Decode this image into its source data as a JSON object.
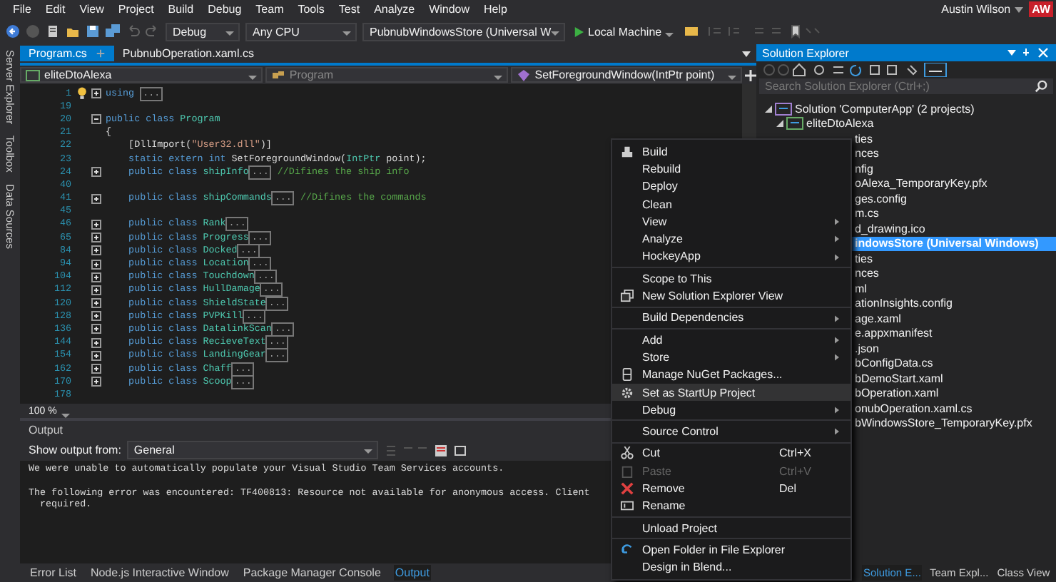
{
  "menu_bar": {
    "items": [
      "File",
      "Edit",
      "View",
      "Project",
      "Build",
      "Debug",
      "Team",
      "Tools",
      "Test",
      "Analyze",
      "Window",
      "Help"
    ],
    "user_name": "Austin Wilson",
    "user_initials": "AW"
  },
  "toolbar": {
    "configuration": "Debug",
    "platform": "Any CPU",
    "startup_project": "PubnubWindowsStore (Universal W",
    "run_target": "Local Machine"
  },
  "side_tabs": [
    "Server Explorer",
    "Toolbox",
    "Data Sources"
  ],
  "document_tabs": [
    {
      "label": "Program.cs",
      "selected": true
    },
    {
      "label": "PubnubOperation.xaml.cs",
      "selected": false
    }
  ],
  "navigation_bar": {
    "project": "eliteDtoAlexa",
    "type": "Program",
    "member": "SetForegroundWindow(IntPtr point)"
  },
  "editor": {
    "zoom": "100 %",
    "lines": [
      {
        "number": "1",
        "lightbulb": true,
        "collapsed": true,
        "tokens": [
          {
            "kind": "keyword",
            "text": "using "
          },
          {
            "kind": "collapsed",
            "text": "..."
          }
        ]
      },
      {
        "number": "19"
      },
      {
        "number": "20",
        "collapsed": false,
        "tokens": [
          {
            "kind": "keyword",
            "text": "public class "
          },
          {
            "kind": "type",
            "text": "Program"
          }
        ]
      },
      {
        "number": "21",
        "tokens": [
          {
            "kind": "plain",
            "text": "{"
          }
        ]
      },
      {
        "number": "22",
        "tokens": [
          {
            "kind": "plain",
            "text": "    [DllImport("
          },
          {
            "kind": "string",
            "text": "\"User32.dll\""
          },
          {
            "kind": "plain",
            "text": ")]"
          }
        ]
      },
      {
        "number": "23",
        "tokens": [
          {
            "kind": "keyword",
            "text": "    static extern int "
          },
          {
            "kind": "plain",
            "text": "SetForegroundWindow("
          },
          {
            "kind": "type",
            "text": "IntPtr"
          },
          {
            "kind": "plain",
            "text": " point);"
          }
        ]
      },
      {
        "number": "24",
        "collapsed": true,
        "tokens": [
          {
            "kind": "keyword",
            "text": "    public class "
          },
          {
            "kind": "type",
            "text": "shipInfo"
          },
          {
            "kind": "collapsed",
            "text": "..."
          },
          {
            "kind": "comment",
            "text": " //Difines the ship info"
          }
        ]
      },
      {
        "number": "40"
      },
      {
        "number": "41",
        "collapsed": true,
        "tokens": [
          {
            "kind": "keyword",
            "text": "    public class "
          },
          {
            "kind": "type",
            "text": "shipCommands"
          },
          {
            "kind": "collapsed",
            "text": "..."
          },
          {
            "kind": "comment",
            "text": " //Difines the commands"
          }
        ]
      },
      {
        "number": "45"
      },
      {
        "number": "46",
        "collapsed": true,
        "tokens": [
          {
            "kind": "keyword",
            "text": "    public class "
          },
          {
            "kind": "type",
            "text": "Rank"
          },
          {
            "kind": "collapsed",
            "text": "..."
          }
        ]
      },
      {
        "number": "65",
        "collapsed": true,
        "tokens": [
          {
            "kind": "keyword",
            "text": "    public class "
          },
          {
            "kind": "type",
            "text": "Progress"
          },
          {
            "kind": "collapsed",
            "text": "..."
          }
        ]
      },
      {
        "number": "84",
        "collapsed": true,
        "tokens": [
          {
            "kind": "keyword",
            "text": "    public class "
          },
          {
            "kind": "type",
            "text": "Docked"
          },
          {
            "kind": "collapsed",
            "text": "..."
          }
        ]
      },
      {
        "number": "94",
        "collapsed": true,
        "tokens": [
          {
            "kind": "keyword",
            "text": "    public class "
          },
          {
            "kind": "type",
            "text": "Location"
          },
          {
            "kind": "collapsed",
            "text": "..."
          }
        ]
      },
      {
        "number": "104",
        "collapsed": true,
        "tokens": [
          {
            "kind": "keyword",
            "text": "    public class "
          },
          {
            "kind": "type",
            "text": "Touchdown"
          },
          {
            "kind": "collapsed",
            "text": "..."
          }
        ]
      },
      {
        "number": "112",
        "collapsed": true,
        "tokens": [
          {
            "kind": "keyword",
            "text": "    public class "
          },
          {
            "kind": "type",
            "text": "HullDamage"
          },
          {
            "kind": "collapsed",
            "text": "..."
          }
        ]
      },
      {
        "number": "120",
        "collapsed": true,
        "tokens": [
          {
            "kind": "keyword",
            "text": "    public class "
          },
          {
            "kind": "type",
            "text": "ShieldState"
          },
          {
            "kind": "collapsed",
            "text": "..."
          }
        ]
      },
      {
        "number": "128",
        "collapsed": true,
        "tokens": [
          {
            "kind": "keyword",
            "text": "    public class "
          },
          {
            "kind": "type",
            "text": "PVPKill"
          },
          {
            "kind": "collapsed",
            "text": "..."
          }
        ]
      },
      {
        "number": "136",
        "collapsed": true,
        "tokens": [
          {
            "kind": "keyword",
            "text": "    public class "
          },
          {
            "kind": "type",
            "text": "DatalinkScan"
          },
          {
            "kind": "collapsed",
            "text": "..."
          }
        ]
      },
      {
        "number": "144",
        "collapsed": true,
        "tokens": [
          {
            "kind": "keyword",
            "text": "    public class "
          },
          {
            "kind": "type",
            "text": "RecieveText"
          },
          {
            "kind": "collapsed",
            "text": "..."
          }
        ]
      },
      {
        "number": "154",
        "collapsed": true,
        "tokens": [
          {
            "kind": "keyword",
            "text": "    public class "
          },
          {
            "kind": "type",
            "text": "LandingGear"
          },
          {
            "kind": "collapsed",
            "text": "..."
          }
        ]
      },
      {
        "number": "162",
        "collapsed": true,
        "tokens": [
          {
            "kind": "keyword",
            "text": "    public class "
          },
          {
            "kind": "type",
            "text": "Chaff"
          },
          {
            "kind": "collapsed",
            "text": "..."
          }
        ]
      },
      {
        "number": "170",
        "collapsed": true,
        "tokens": [
          {
            "kind": "keyword",
            "text": "    public class "
          },
          {
            "kind": "type",
            "text": "Scoop"
          },
          {
            "kind": "collapsed",
            "text": "..."
          }
        ]
      },
      {
        "number": "178"
      }
    ]
  },
  "output": {
    "title": "Output",
    "source_label": "Show output from:",
    "source": "General",
    "messages": [
      {
        "lines": [
          "We were unable to automatically populate your Visual Studio Team Services accounts."
        ]
      },
      {
        "lines": [
          "The following error was encountered: TF400813: Resource not available for anonymous access. Client",
          "required."
        ]
      }
    ]
  },
  "bottom_tabs": [
    {
      "label": "Error List",
      "selected": false
    },
    {
      "label": "Node.js Interactive Window",
      "selected": false
    },
    {
      "label": "Package Manager Console",
      "selected": false
    },
    {
      "label": "Output",
      "selected": true
    }
  ],
  "solution_explorer": {
    "title": "Solution Explorer",
    "search": {
      "placeholder": "Search Solution Explorer (Ctrl+;)"
    },
    "tree": [
      {
        "label": "Solution 'ComputerApp' (2 projects)",
        "selected": false,
        "expanded": true,
        "children": [
          {
            "label": "eliteDtoAlexa",
            "selected": false,
            "expanded": true,
            "children": [
              {
                "label": "ties",
                "partly_hidden": true,
                "selected": false
              },
              {
                "label": "nces",
                "partly_hidden": true,
                "selected": false
              },
              {
                "label": "nfig",
                "partly_hidden": true,
                "selected": false
              },
              {
                "label": "oAlexa_TemporaryKey.pfx",
                "partly_hidden": true,
                "selected": false
              },
              {
                "label": "ges.config",
                "partly_hidden": true,
                "selected": false
              },
              {
                "label": "m.cs",
                "partly_hidden": true,
                "selected": false
              },
              {
                "label": "d_drawing.ico",
                "partly_hidden": true,
                "selected": false
              }
            ]
          },
          {
            "label": "indowsStore (Universal Windows)",
            "partly_hidden": true,
            "selected": true,
            "children": [
              {
                "label": "ties",
                "partly_hidden": true,
                "selected": false
              },
              {
                "label": "nces",
                "partly_hidden": true,
                "selected": false
              },
              {
                "label": "ml",
                "partly_hidden": true,
                "selected": false
              },
              {
                "label": "ationInsights.config",
                "partly_hidden": true,
                "selected": false
              },
              {
                "label": "age.xaml",
                "partly_hidden": true,
                "selected": false
              },
              {
                "label": "e.appxmanifest",
                "partly_hidden": true,
                "selected": false
              },
              {
                "label": ".json",
                "partly_hidden": true,
                "selected": false
              },
              {
                "label": "bConfigData.cs",
                "partly_hidden": true,
                "selected": false
              },
              {
                "label": "bDemoStart.xaml",
                "partly_hidden": true,
                "selected": false
              },
              {
                "label": "bOperation.xaml",
                "partly_hidden": true,
                "selected": false
              },
              {
                "label": "onubOperation.xaml.cs",
                "partly_hidden": true,
                "selected": false
              },
              {
                "label": "bWindowsStore_TemporaryKey.pfx",
                "partly_hidden": true,
                "selected": false
              }
            ]
          }
        ]
      }
    ],
    "tabs": [
      {
        "label": "Solution E...",
        "selected": true
      },
      {
        "label": "Team Expl...",
        "selected": false
      },
      {
        "label": "Class View",
        "selected": false
      }
    ]
  },
  "context_menu": {
    "groups": [
      [
        {
          "label": "Build",
          "submenu": false,
          "disabled": false,
          "selected": false
        },
        {
          "label": "Rebuild",
          "submenu": false,
          "disabled": false,
          "selected": false
        },
        {
          "label": "Deploy",
          "submenu": false,
          "disabled": false,
          "selected": false
        },
        {
          "label": "Clean",
          "submenu": false,
          "disabled": false,
          "selected": false
        },
        {
          "label": "View",
          "submenu": true,
          "disabled": false,
          "selected": false
        },
        {
          "label": "Analyze",
          "submenu": true,
          "disabled": false,
          "selected": false
        },
        {
          "label": "HockeyApp",
          "submenu": true,
          "disabled": false,
          "selected": false
        }
      ],
      [
        {
          "label": "Scope to This",
          "submenu": false,
          "disabled": false,
          "selected": false
        },
        {
          "label": "New Solution Explorer View",
          "submenu": false,
          "disabled": false,
          "selected": false
        }
      ],
      [
        {
          "label": "Build Dependencies",
          "submenu": true,
          "disabled": false,
          "selected": false
        }
      ],
      [
        {
          "label": "Add",
          "submenu": true,
          "disabled": false,
          "selected": false
        },
        {
          "label": "Store",
          "submenu": true,
          "disabled": false,
          "selected": false
        },
        {
          "label": "Manage NuGet Packages...",
          "submenu": false,
          "disabled": false,
          "selected": false
        },
        {
          "label": "Set as StartUp Project",
          "submenu": false,
          "disabled": false,
          "selected": true
        },
        {
          "label": "Debug",
          "submenu": true,
          "disabled": false,
          "selected": false
        }
      ],
      [
        {
          "label": "Source Control",
          "submenu": true,
          "disabled": false,
          "selected": false
        }
      ],
      [
        {
          "label": "Cut",
          "shortcut": "Ctrl+X",
          "submenu": false,
          "disabled": false,
          "selected": false
        },
        {
          "label": "Paste",
          "shortcut": "Ctrl+V",
          "submenu": false,
          "disabled": true,
          "selected": false
        },
        {
          "label": "Remove",
          "shortcut": "Del",
          "submenu": false,
          "disabled": false,
          "selected": false
        },
        {
          "label": "Rename",
          "submenu": false,
          "disabled": false,
          "selected": false
        }
      ],
      [
        {
          "label": "Unload Project",
          "submenu": false,
          "disabled": false,
          "selected": false
        }
      ],
      [
        {
          "label": "Open Folder in File Explorer",
          "submenu": false,
          "disabled": false,
          "selected": false
        },
        {
          "label": "Design in Blend...",
          "submenu": false,
          "disabled": false,
          "selected": false
        }
      ]
    ]
  }
}
